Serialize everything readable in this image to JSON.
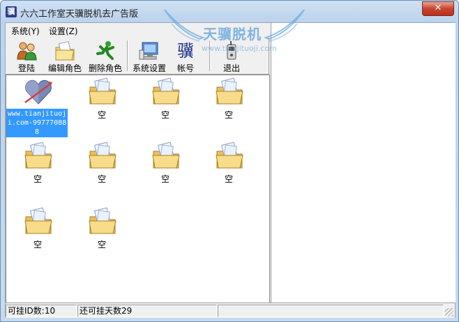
{
  "window": {
    "title": "六六工作室天骥脱机去广告版",
    "app_icon": "骥",
    "close_glyph": "✕"
  },
  "watermark": {
    "brand": "天骥脱机",
    "url": "www.tianjituoji.com"
  },
  "menu": [
    {
      "label": "系统(Y)"
    },
    {
      "label": "设置(Z)"
    }
  ],
  "toolbar": [
    {
      "label": "登陆",
      "icon": "login-users-icon"
    },
    {
      "label": "编辑角色",
      "icon": "edit-folder-icon"
    },
    {
      "label": "删除角色",
      "icon": "running-man-icon"
    },
    {
      "label": "系统设置",
      "icon": "computer-settings-icon"
    },
    {
      "label": "帐号",
      "icon": "account-char-icon",
      "glyph": "骥"
    },
    {
      "label": "退出",
      "icon": "exit-phone-icon"
    }
  ],
  "items": [
    {
      "label": "www.tianjituoji.com-997770888",
      "icon": "heart-icon",
      "selected": true
    },
    {
      "label": "空",
      "icon": "folder-icon"
    },
    {
      "label": "空",
      "icon": "folder-icon"
    },
    {
      "label": "空",
      "icon": "folder-icon"
    },
    {
      "label": "空",
      "icon": "folder-icon"
    },
    {
      "label": "空",
      "icon": "folder-icon"
    },
    {
      "label": "空",
      "icon": "folder-icon"
    },
    {
      "label": "空",
      "icon": "folder-icon"
    },
    {
      "label": "空",
      "icon": "folder-icon"
    },
    {
      "label": "空",
      "icon": "folder-icon"
    }
  ],
  "status": {
    "ids": "可挂ID数:10",
    "days": "还可挂天数29",
    "extra": ""
  }
}
